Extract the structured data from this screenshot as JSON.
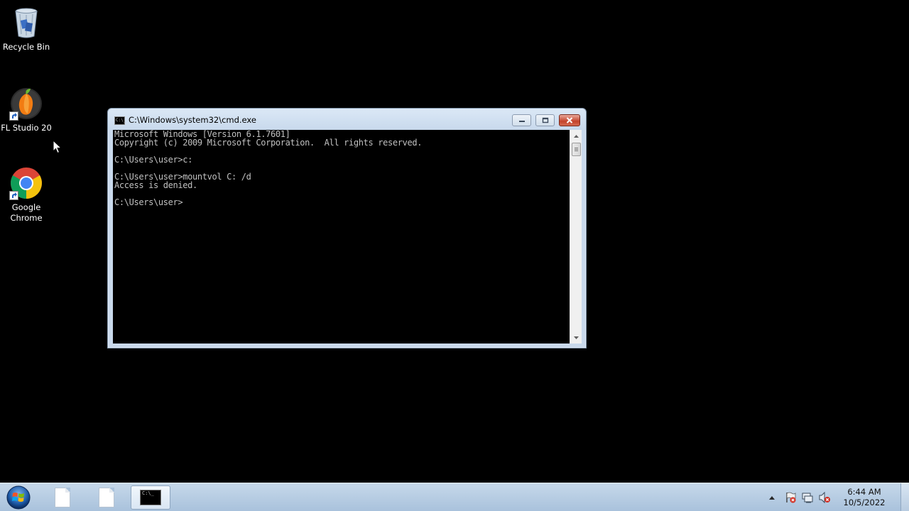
{
  "desktop": {
    "icons": [
      {
        "label": "Recycle Bin",
        "icon": "recycle-bin-icon"
      },
      {
        "label": "FL Studio 20",
        "icon": "fl-studio-icon"
      },
      {
        "label": "Google Chrome",
        "icon": "chrome-icon"
      }
    ]
  },
  "cmd_window": {
    "title": "C:\\Windows\\system32\\cmd.exe",
    "console_lines": [
      "Microsoft Windows [Version 6.1.7601]",
      "Copyright (c) 2009 Microsoft Corporation.  All rights reserved.",
      "",
      "C:\\Users\\user>c:",
      "",
      "C:\\Users\\user>mountvol C: /d",
      "Access is denied.",
      "",
      "C:\\Users\\user>"
    ]
  },
  "taskbar": {
    "buttons": [
      {
        "icon": "document-icon",
        "active": false
      },
      {
        "icon": "document-icon",
        "active": false
      },
      {
        "icon": "cmd-icon",
        "active": true
      }
    ],
    "tray_icons": [
      "show-hidden-icons-arrow",
      "action-center-flag-icon",
      "network-icon",
      "volume-muted-icon"
    ],
    "clock_time": "6:44 AM",
    "clock_date": "10/5/2022",
    "cmd_icon_text": "C:\\_"
  },
  "colors": {
    "desktop_background": "#000000",
    "console_text": "#c0c0c0",
    "taskbar": "#b4cbe2",
    "close_button": "#c4432b"
  }
}
